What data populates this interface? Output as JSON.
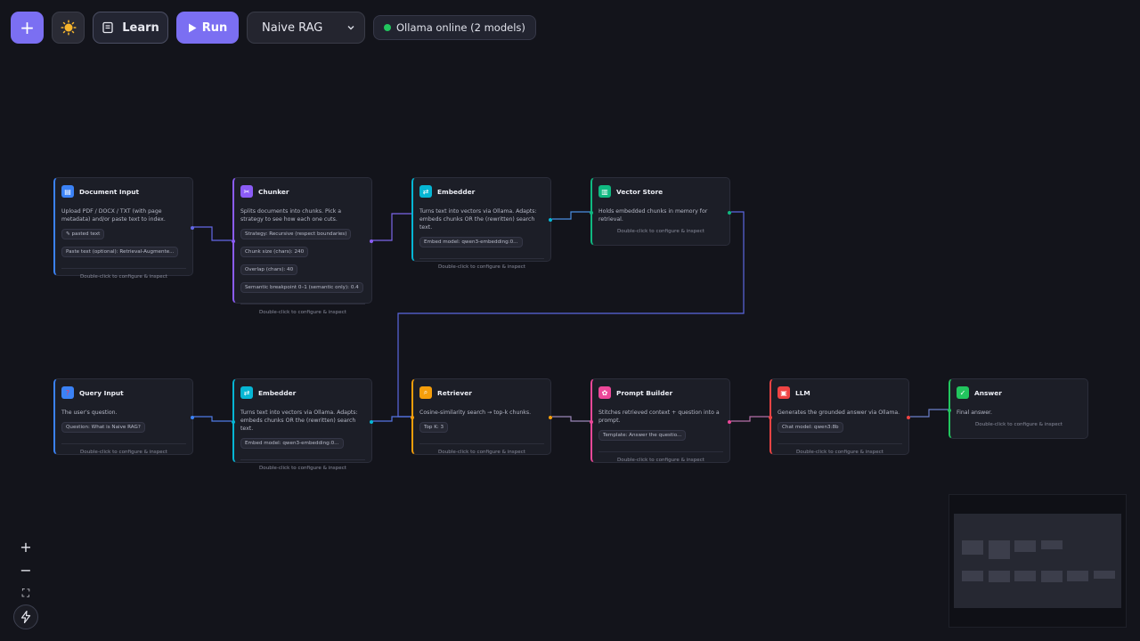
{
  "toolbar": {
    "add_icon": "+",
    "theme_icon": "sun-icon",
    "learn_label": "Learn",
    "run_label": "Run",
    "pipeline_selected": "Naive RAG",
    "status_text": "Ollama online (2 models)",
    "status_color": "#22c55e"
  },
  "nodes": {
    "document_input": {
      "title": "Document Input",
      "desc": "Upload PDF / DOCX / TXT (with page metadata) and/or paste text to index.",
      "chips": [
        "✎ pasted text",
        "Paste text (optional): Retrieval-Augmente..."
      ],
      "footer": "Double-click to configure & inspect",
      "color": "#3b82f6"
    },
    "chunker": {
      "title": "Chunker",
      "desc": "Splits documents into chunks. Pick a strategy to see how each one cuts.",
      "chips": [
        "Strategy: Recursive (respect boundaries)",
        "Chunk size (chars): 240",
        "Overlap (chars): 40",
        "Semantic breakpoint 0–1 (semantic only): 0.4"
      ],
      "footer": "Double-click to configure & inspect",
      "color": "#8b5cf6"
    },
    "embedder_top": {
      "title": "Embedder",
      "desc": "Turns text into vectors via Ollama. Adapts: embeds chunks OR the (rewritten) search text.",
      "chips": [
        "Embed model: qwen3-embedding:0..."
      ],
      "footer": "Double-click to configure & inspect",
      "color": "#06b6d4"
    },
    "vector_store": {
      "title": "Vector Store",
      "desc": "Holds embedded chunks in memory for retrieval.",
      "chips": [],
      "footer": "Double-click to configure & inspect",
      "color": "#10b981"
    },
    "query_input": {
      "title": "Query Input",
      "desc": "The user's question.",
      "chips": [
        "Question: What is Naive RAG?"
      ],
      "footer": "Double-click to configure & inspect",
      "color": "#3b82f6"
    },
    "embedder_bottom": {
      "title": "Embedder",
      "desc": "Turns text into vectors via Ollama. Adapts: embeds chunks OR the (rewritten) search text.",
      "chips": [
        "Embed model: qwen3-embedding:0..."
      ],
      "footer": "Double-click to configure & inspect",
      "color": "#06b6d4"
    },
    "retriever": {
      "title": "Retriever",
      "desc": "Cosine-similarity search → top-k chunks.",
      "chips": [
        "Top K: 3"
      ],
      "footer": "Double-click to configure & inspect",
      "color": "#f59e0b"
    },
    "prompt_builder": {
      "title": "Prompt Builder",
      "desc": "Stitches retrieved context + question into a prompt.",
      "chips": [
        "Template: Answer the questio..."
      ],
      "footer": "Double-click to configure & inspect",
      "color": "#ec4899"
    },
    "llm": {
      "title": "LLM",
      "desc": "Generates the grounded answer via Ollama.",
      "chips": [
        "Chat model: qwen3:8b"
      ],
      "footer": "Double-click to configure & inspect",
      "color": "#ef4444"
    },
    "answer": {
      "title": "Answer",
      "desc": "Final answer.",
      "chips": [],
      "footer": "Double-click to configure & inspect",
      "color": "#22c55e"
    }
  },
  "zoom": {
    "zoom_in": "+",
    "zoom_out": "−",
    "fit": "⛶",
    "interactive": "ϟ"
  }
}
